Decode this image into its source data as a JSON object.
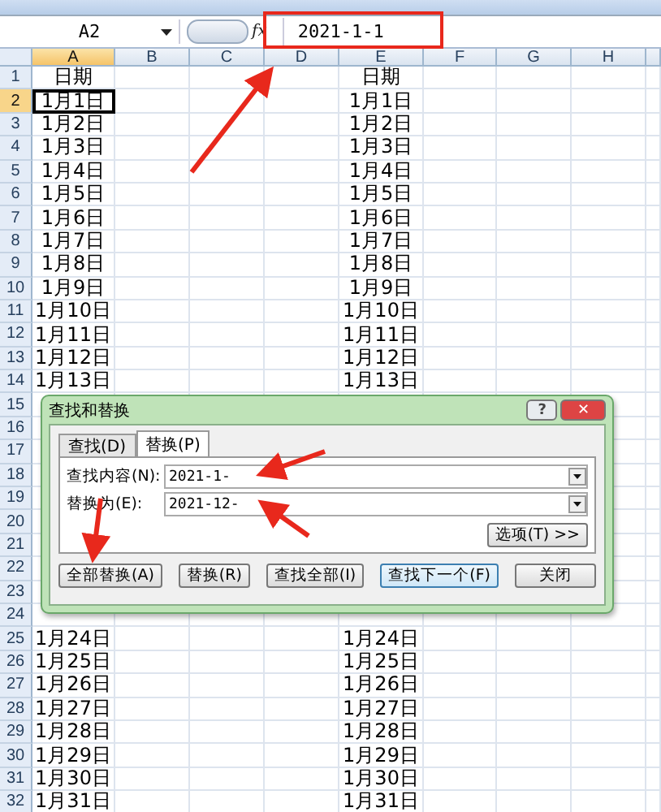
{
  "formula_bar": {
    "name_box": "A2",
    "function_label": "fx",
    "value": "2021-1-1"
  },
  "columns": [
    {
      "label": "A",
      "selected": true
    },
    {
      "label": "B",
      "selected": false
    },
    {
      "label": "C",
      "selected": false
    },
    {
      "label": "D",
      "selected": false
    },
    {
      "label": "E",
      "selected": false
    },
    {
      "label": "F",
      "selected": false
    },
    {
      "label": "G",
      "selected": false
    },
    {
      "label": "H",
      "selected": false
    }
  ],
  "rows": [
    {
      "num": "1",
      "selected": false,
      "a": "日期",
      "e": "日期"
    },
    {
      "num": "2",
      "selected": true,
      "a": "1月1日",
      "e": "1月1日"
    },
    {
      "num": "3",
      "selected": false,
      "a": "1月2日",
      "e": "1月2日"
    },
    {
      "num": "4",
      "selected": false,
      "a": "1月3日",
      "e": "1月3日"
    },
    {
      "num": "5",
      "selected": false,
      "a": "1月4日",
      "e": "1月4日"
    },
    {
      "num": "6",
      "selected": false,
      "a": "1月5日",
      "e": "1月5日"
    },
    {
      "num": "7",
      "selected": false,
      "a": "1月6日",
      "e": "1月6日"
    },
    {
      "num": "8",
      "selected": false,
      "a": "1月7日",
      "e": "1月7日"
    },
    {
      "num": "9",
      "selected": false,
      "a": "1月8日",
      "e": "1月8日"
    },
    {
      "num": "10",
      "selected": false,
      "a": "1月9日",
      "e": "1月9日"
    },
    {
      "num": "11",
      "selected": false,
      "a": "1月10日",
      "e": "1月10日"
    },
    {
      "num": "12",
      "selected": false,
      "a": "1月11日",
      "e": "1月11日"
    },
    {
      "num": "13",
      "selected": false,
      "a": "1月12日",
      "e": "1月12日"
    },
    {
      "num": "14",
      "selected": false,
      "a": "1月13日",
      "e": "1月13日"
    },
    {
      "num": "15",
      "selected": false
    },
    {
      "num": "16",
      "selected": false
    },
    {
      "num": "17",
      "selected": false
    },
    {
      "num": "18",
      "selected": false
    },
    {
      "num": "19",
      "selected": false
    },
    {
      "num": "20",
      "selected": false
    },
    {
      "num": "21",
      "selected": false
    },
    {
      "num": "22",
      "selected": false
    },
    {
      "num": "23",
      "selected": false
    },
    {
      "num": "24",
      "selected": false
    },
    {
      "num": "25",
      "selected": false,
      "a": "1月24日",
      "e": "1月24日"
    },
    {
      "num": "26",
      "selected": false,
      "a": "1月25日",
      "e": "1月25日"
    },
    {
      "num": "27",
      "selected": false,
      "a": "1月26日",
      "e": "1月26日"
    },
    {
      "num": "28",
      "selected": false,
      "a": "1月27日",
      "e": "1月27日"
    },
    {
      "num": "29",
      "selected": false,
      "a": "1月28日",
      "e": "1月28日"
    },
    {
      "num": "30",
      "selected": false,
      "a": "1月29日",
      "e": "1月29日"
    },
    {
      "num": "31",
      "selected": false,
      "a": "1月30日",
      "e": "1月30日"
    },
    {
      "num": "32",
      "selected": false,
      "a": "1月31日",
      "e": "1月31日"
    }
  ],
  "dialog": {
    "title": "查找和替换",
    "help": "?",
    "close": "✕",
    "tabs": [
      {
        "label": "查找(D)",
        "selected": false
      },
      {
        "label": "替换(P)",
        "selected": true
      }
    ],
    "fields": [
      {
        "label": "查找内容(N):",
        "value": "2021-1-"
      },
      {
        "label": "替换为(E):",
        "value": "2021-12-"
      }
    ],
    "options_button": "选项(T) >>",
    "buttons": [
      {
        "label": "全部替换(A)",
        "default": false
      },
      {
        "label": "替换(R)",
        "default": false
      },
      {
        "label": "查找全部(I)",
        "default": false
      },
      {
        "label": "查找下一个(F)",
        "default": true
      },
      {
        "label": "关闭",
        "default": false
      }
    ]
  }
}
